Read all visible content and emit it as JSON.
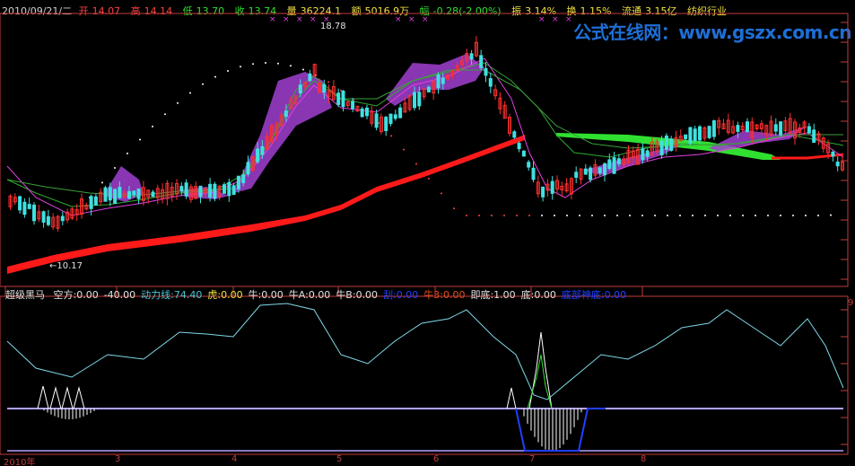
{
  "info_bar": {
    "date": "2010/09/21/二",
    "open_label": "开",
    "open": "14.07",
    "high_label": "高",
    "high": "14.14",
    "low_label": "低",
    "low": "13.70",
    "close_label": "收",
    "close": "13.74",
    "volume_label": "量",
    "volume": "36224.1",
    "amount_label": "额",
    "amount": "5016.9万",
    "change_label": "幅",
    "change": "-0.28(-2.00%)",
    "amplitude_label": "振",
    "amplitude": "3.14%",
    "turnover_label": "换",
    "turnover": "1.15%",
    "float_label": "流通",
    "float": "3.15亿",
    "industry": "纺织行业"
  },
  "watermark": "公式在线网：www.gszx.com.cn",
  "price_annotations": {
    "high_marker": "18.78",
    "low_marker": "←10.17"
  },
  "indicator_bar": {
    "name": "超级黑马",
    "items": [
      {
        "label": "空方:0.00",
        "color": "#e0e0e0"
      },
      {
        "label": "-40.00",
        "color": "#e0e0e0"
      },
      {
        "label": "动力线:74.40",
        "color": "#49c6d6"
      },
      {
        "label": "虎:0.00",
        "color": "#f0e040"
      },
      {
        "label": "牛:0.00",
        "color": "#e0e0e0"
      },
      {
        "label": "牛A:0.00",
        "color": "#e0e0e0"
      },
      {
        "label": "牛B:0.00",
        "color": "#e0e0e0"
      },
      {
        "label": "刮:0.00",
        "color": "#2040ff"
      },
      {
        "label": "牛3:0.00",
        "color": "#e05020"
      },
      {
        "label": "即底:1.00",
        "color": "#e0e0e0"
      },
      {
        "label": "底:0.00",
        "color": "#e0e0e0"
      },
      {
        "label": "底部神底:0.00",
        "color": "#2040ff"
      }
    ]
  },
  "x_axis": [
    "2010年",
    "3",
    "4",
    "5",
    "6",
    "7",
    "8"
  ],
  "right_axis_label": "9",
  "colors": {
    "up": "#ff3030",
    "down": "#40e0e0",
    "ma_red": "#ff1a1a",
    "ma_green": "#30e030",
    "fill_purple": "#a040d0",
    "line_cyan": "#7fd8e8",
    "axis": "#c23b3b"
  }
}
